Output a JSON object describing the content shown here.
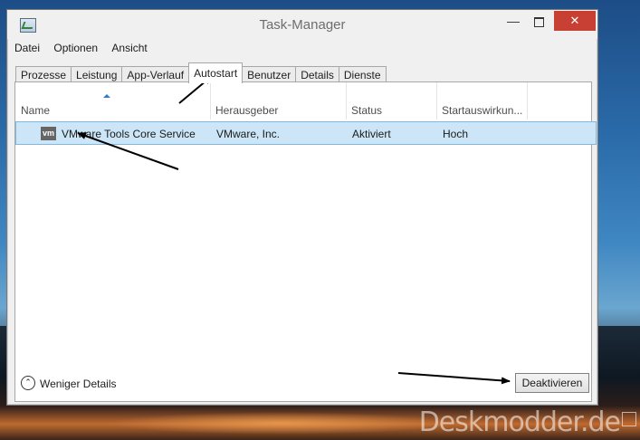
{
  "window": {
    "title": "Task-Manager",
    "close_glyph": "✕",
    "minimize_glyph": "—"
  },
  "menu": [
    "Datei",
    "Optionen",
    "Ansicht"
  ],
  "tabs": [
    "Prozesse",
    "Leistung",
    "App-Verlauf",
    "Autostart",
    "Benutzer",
    "Details",
    "Dienste"
  ],
  "active_tab": "Autostart",
  "columns": [
    "Name",
    "Herausgeber",
    "Status",
    "Startauswirkun..."
  ],
  "rows": [
    {
      "icon": "vm",
      "name": "VMware Tools Core Service",
      "publisher": "VMware, Inc.",
      "status": "Aktiviert",
      "impact": "Hoch",
      "selected": true
    }
  ],
  "footer": {
    "toggle_glyph": "⌃",
    "details_label": "Weniger Details",
    "disable_button": "Deaktivieren"
  },
  "watermark": "Deskmodder.de",
  "colors": {
    "close_button": "#c84033",
    "selection": "#cde6f7",
    "selection_border": "#7fb9e2"
  }
}
